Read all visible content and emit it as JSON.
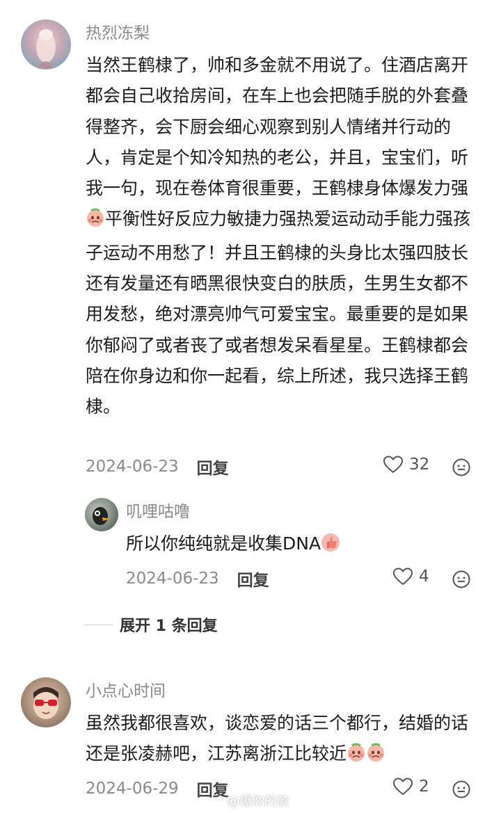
{
  "comments": [
    {
      "username": "热烈冻梨",
      "text": "当然王鹤棣了，帅和多金就不用说了。住酒店离开都会自己收拾房间，在车上也会把随手脱的外套叠得整齐，会下厨会细心观察到别人情绪并行动的人，肯定是个知冷知热的老公，并且，宝宝们，听我一句，现在卷体育很重要，王鹤棣身体爆发力强",
      "text_after_emoji": "平衡性好反应力敏捷力强热爱运动动手能力强孩子运动不用愁了！并且王鹤棣的头身比太强四肢长还有发量还有晒黑很快变白的肤质，生男生女都不用发愁，绝对漂亮帅气可爱宝宝。最重要的是如果你郁闷了或者丧了或者想发呆看星星。王鹤棣都会陪在你身边和你一起看，综上所述，我只选择王鹤棣。",
      "date": "2024-06-23",
      "reply_label": "回复",
      "likes": "32"
    },
    {
      "username": "叽哩咕噜",
      "text": "所以你纯纯就是收集DNA",
      "date": "2024-06-23",
      "reply_label": "回复",
      "likes": "4"
    },
    {
      "username": "小点心时间",
      "text": "虽然我都很喜欢，谈恋爱的话三个都行，结婚的话还是张凌赫吧，江苏离浙江比较近",
      "date": "2024-06-29",
      "reply_label": "回复",
      "likes": "2"
    }
  ],
  "expand_replies": "展开 1 条回复",
  "watermark": "@爆你的款",
  "colors": {
    "meta_gray": "#8a8a8a",
    "text": "#1c1c1c"
  }
}
